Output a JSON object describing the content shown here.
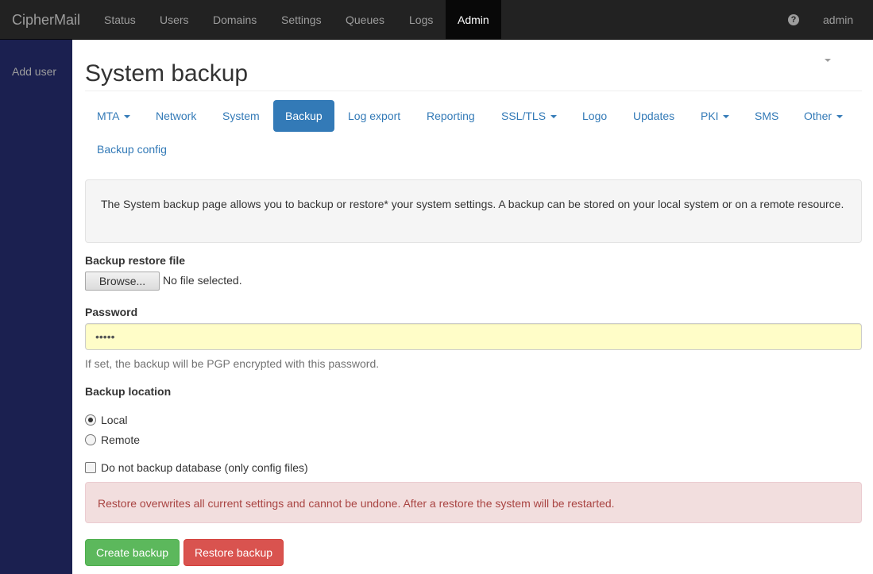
{
  "navbar": {
    "brand": "CipherMail",
    "items": [
      {
        "label": "Status"
      },
      {
        "label": "Users"
      },
      {
        "label": "Domains"
      },
      {
        "label": "Settings"
      },
      {
        "label": "Queues"
      },
      {
        "label": "Logs"
      },
      {
        "label": "Admin",
        "active": true
      }
    ],
    "help_icon": "question-circle-icon",
    "user": "admin"
  },
  "sidebar": {
    "items": [
      {
        "label": "Add user"
      }
    ]
  },
  "page": {
    "title": "System backup"
  },
  "tabs": [
    {
      "label": "MTA",
      "dropdown": true
    },
    {
      "label": "Network"
    },
    {
      "label": "System"
    },
    {
      "label": "Backup",
      "active": true
    },
    {
      "label": "Log export"
    },
    {
      "label": "Reporting"
    },
    {
      "label": "SSL/TLS",
      "dropdown": true
    },
    {
      "label": "Logo"
    },
    {
      "label": "Updates"
    },
    {
      "label": "PKI",
      "dropdown": true
    },
    {
      "label": "SMS"
    },
    {
      "label": "Other",
      "dropdown": true
    },
    {
      "label": "Backup config"
    }
  ],
  "info": {
    "text": "The System backup page allows you to backup or restore* your system settings. A backup can be stored on your local system or on a remote resource."
  },
  "form": {
    "restore_file_label": "Backup restore file",
    "browse_label": "Browse...",
    "file_status": "No file selected.",
    "password_label": "Password",
    "password_value": "•••••",
    "password_help": "If set, the backup will be PGP encrypted with this password.",
    "location_label": "Backup location",
    "location_options": [
      {
        "label": "Local",
        "checked": true
      },
      {
        "label": "Remote",
        "checked": false
      }
    ],
    "no_db_label": "Do not backup database (only config files)",
    "no_db_checked": false
  },
  "alert": {
    "text": "Restore overwrites all current settings and cannot be undone. After a restore the system will be restarted."
  },
  "buttons": {
    "create": "Create backup",
    "restore": "Restore backup"
  },
  "colors": {
    "primary": "#337ab7",
    "success": "#5cb85c",
    "danger": "#d9534f",
    "sidebar": "#1b2050",
    "navbar": "#222222"
  }
}
